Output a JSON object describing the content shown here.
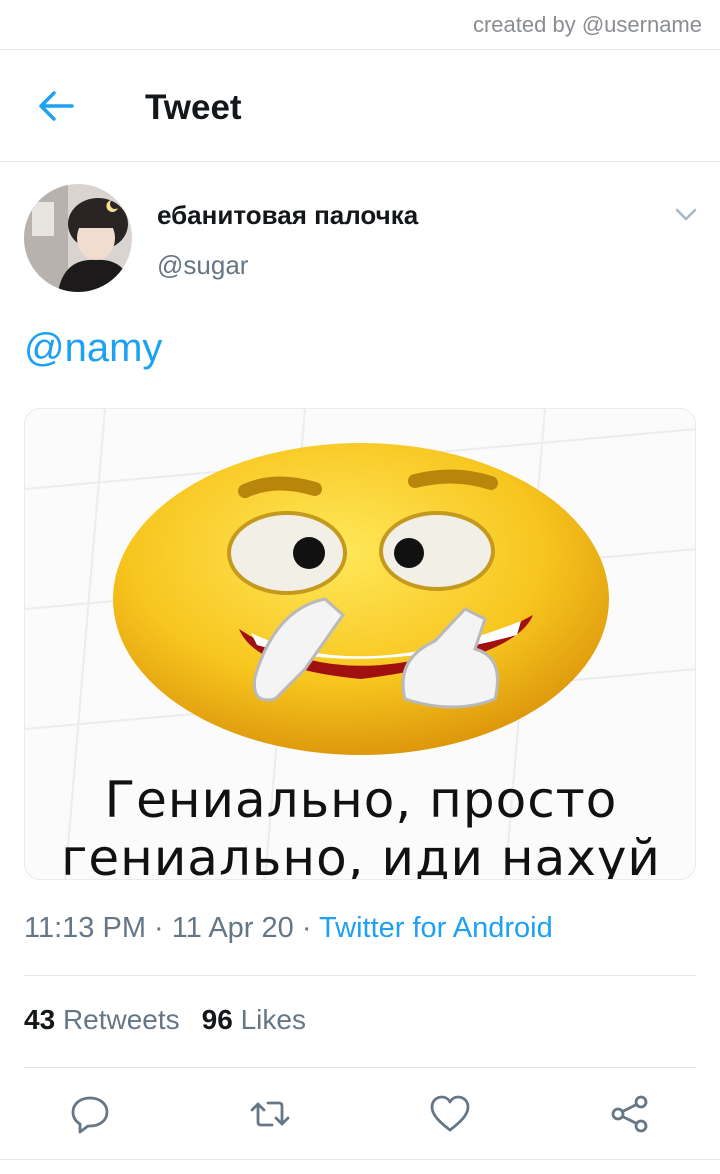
{
  "watermark": {
    "text": "created by @username"
  },
  "header": {
    "title": "Tweet"
  },
  "tweet": {
    "author_name": "ебанитовая палочка",
    "author_handle": "@sugar",
    "text": "@namy",
    "media_caption_line1": "Гениально, просто",
    "media_caption_line2": "гениально, иди нахуй",
    "time": "11:13 PM",
    "date": "11 Apr 20",
    "source": "Twitter for Android",
    "retweets_count": "43",
    "retweets_label": "Retweets",
    "likes_count": "96",
    "likes_label": "Likes"
  },
  "colors": {
    "accent": "#1da1f2",
    "secondary_text": "#657786",
    "primary_text": "#14171a",
    "divider": "#e1e8ed"
  },
  "icons": {
    "back": "arrow-left-icon",
    "caret": "chevron-down-icon",
    "reply": "reply-icon",
    "retweet": "retweet-icon",
    "like": "heart-icon",
    "share": "share-icon"
  }
}
